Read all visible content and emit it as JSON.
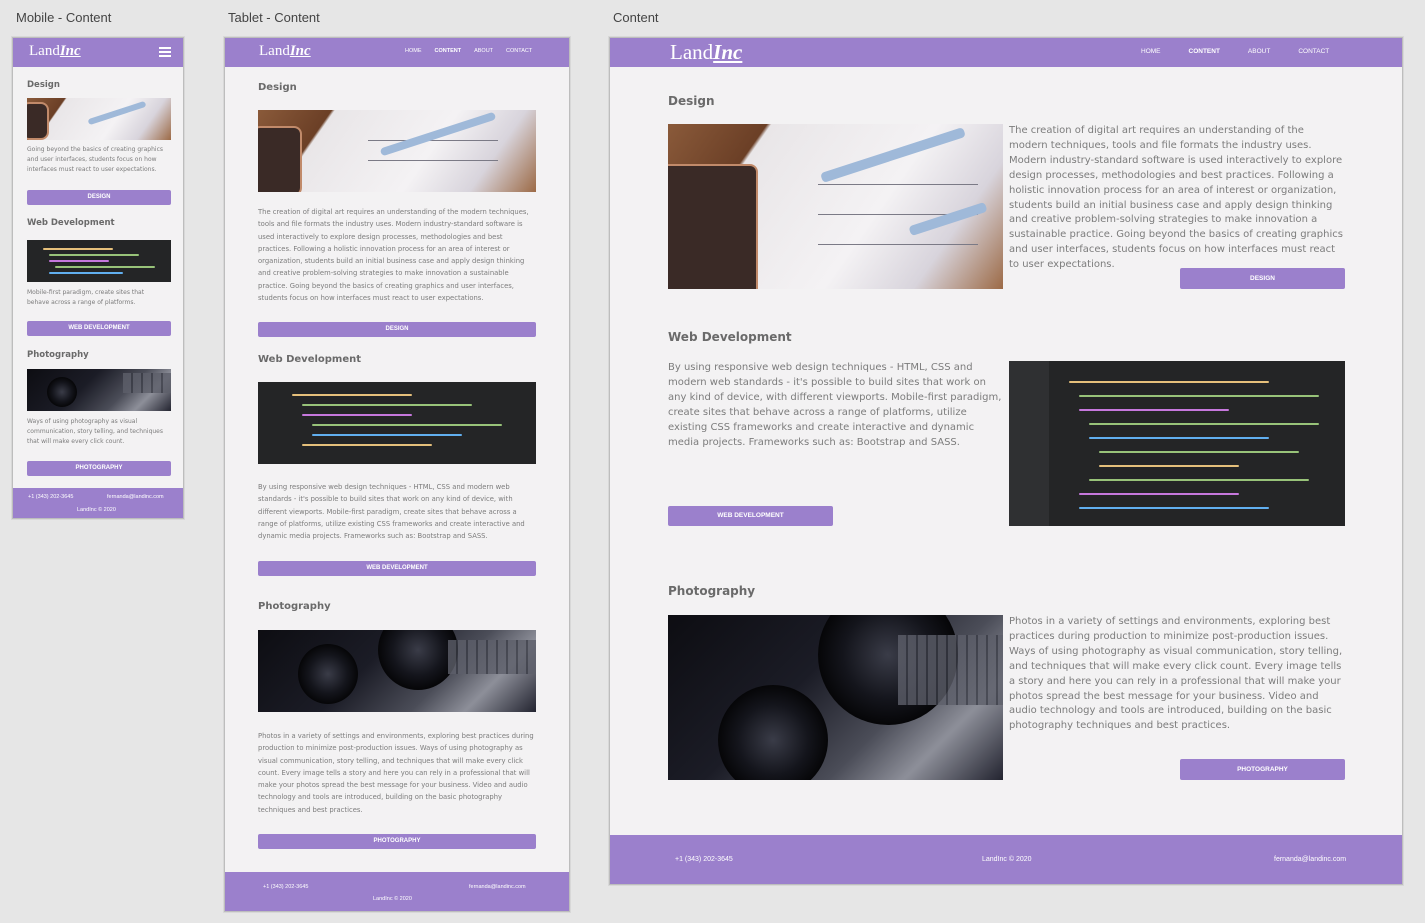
{
  "boards": {
    "mobile_label": "Mobile - Content",
    "tablet_label": "Tablet - Content",
    "desktop_label": "Content"
  },
  "logo": {
    "light": "Land",
    "bold": "Inc"
  },
  "nav": {
    "home": "HOME",
    "content": "CONTENT",
    "about": "ABOUT",
    "contact": "CONTACT"
  },
  "colors": {
    "brand": "#9b80cc",
    "page_bg": "#f3f2f3",
    "canvas_bg": "#e6e6e6"
  },
  "sections": {
    "design": {
      "title": "Design",
      "button": "DESIGN",
      "text_full": "The creation of digital art requires an understanding of the modern techniques, tools and file formats the industry uses. Modern industry-standard software is used interactively to explore design processes, methodologies and best practices. Following a holistic innovation process for an area of interest or organization, students build an initial business case and apply design thinking and creative problem-solving strategies to make innovation a sustainable practice. Going beyond the basics of creating graphics and user interfaces, students focus on how interfaces must react to user expectations.",
      "text_mobile": "Going beyond the basics of creating graphics and user interfaces, students focus on how interfaces must react to user expectations."
    },
    "webdev": {
      "title": "Web Development",
      "button": "WEB DEVELOPMENT",
      "text_full": "By using responsive web design techniques - HTML, CSS and modern web standards - it's possible to build sites that work on any kind of device, with different viewports. Mobile-first paradigm, create sites that behave across a range of platforms, utilize existing CSS frameworks and create interactive and dynamic media projects. Frameworks such as: Bootstrap and SASS.",
      "text_mobile": "Mobile-first paradigm, create sites that behave across a range of platforms."
    },
    "photo": {
      "title": "Photography",
      "button": "PHOTOGRAPHY",
      "text_full": "Photos in a variety of settings and environments, exploring best practices during production to minimize post-production issues. Ways of using photography as visual communication, story telling, and techniques that will make every click count. Every image tells a story and here you can rely in a professional that will make your photos spread the best message for your business. Video and audio technology and tools are introduced, building on the basic photography techniques and best practices.",
      "text_mobile": "Ways of using photography as visual communication, story telling, and techniques that will make every click count."
    }
  },
  "footer": {
    "phone": "+1 (343) 202-3645",
    "email": "fernanda@landinc.com",
    "copyright": "LandInc © 2020"
  },
  "icons": {
    "menu": "hamburger-menu-icon"
  }
}
